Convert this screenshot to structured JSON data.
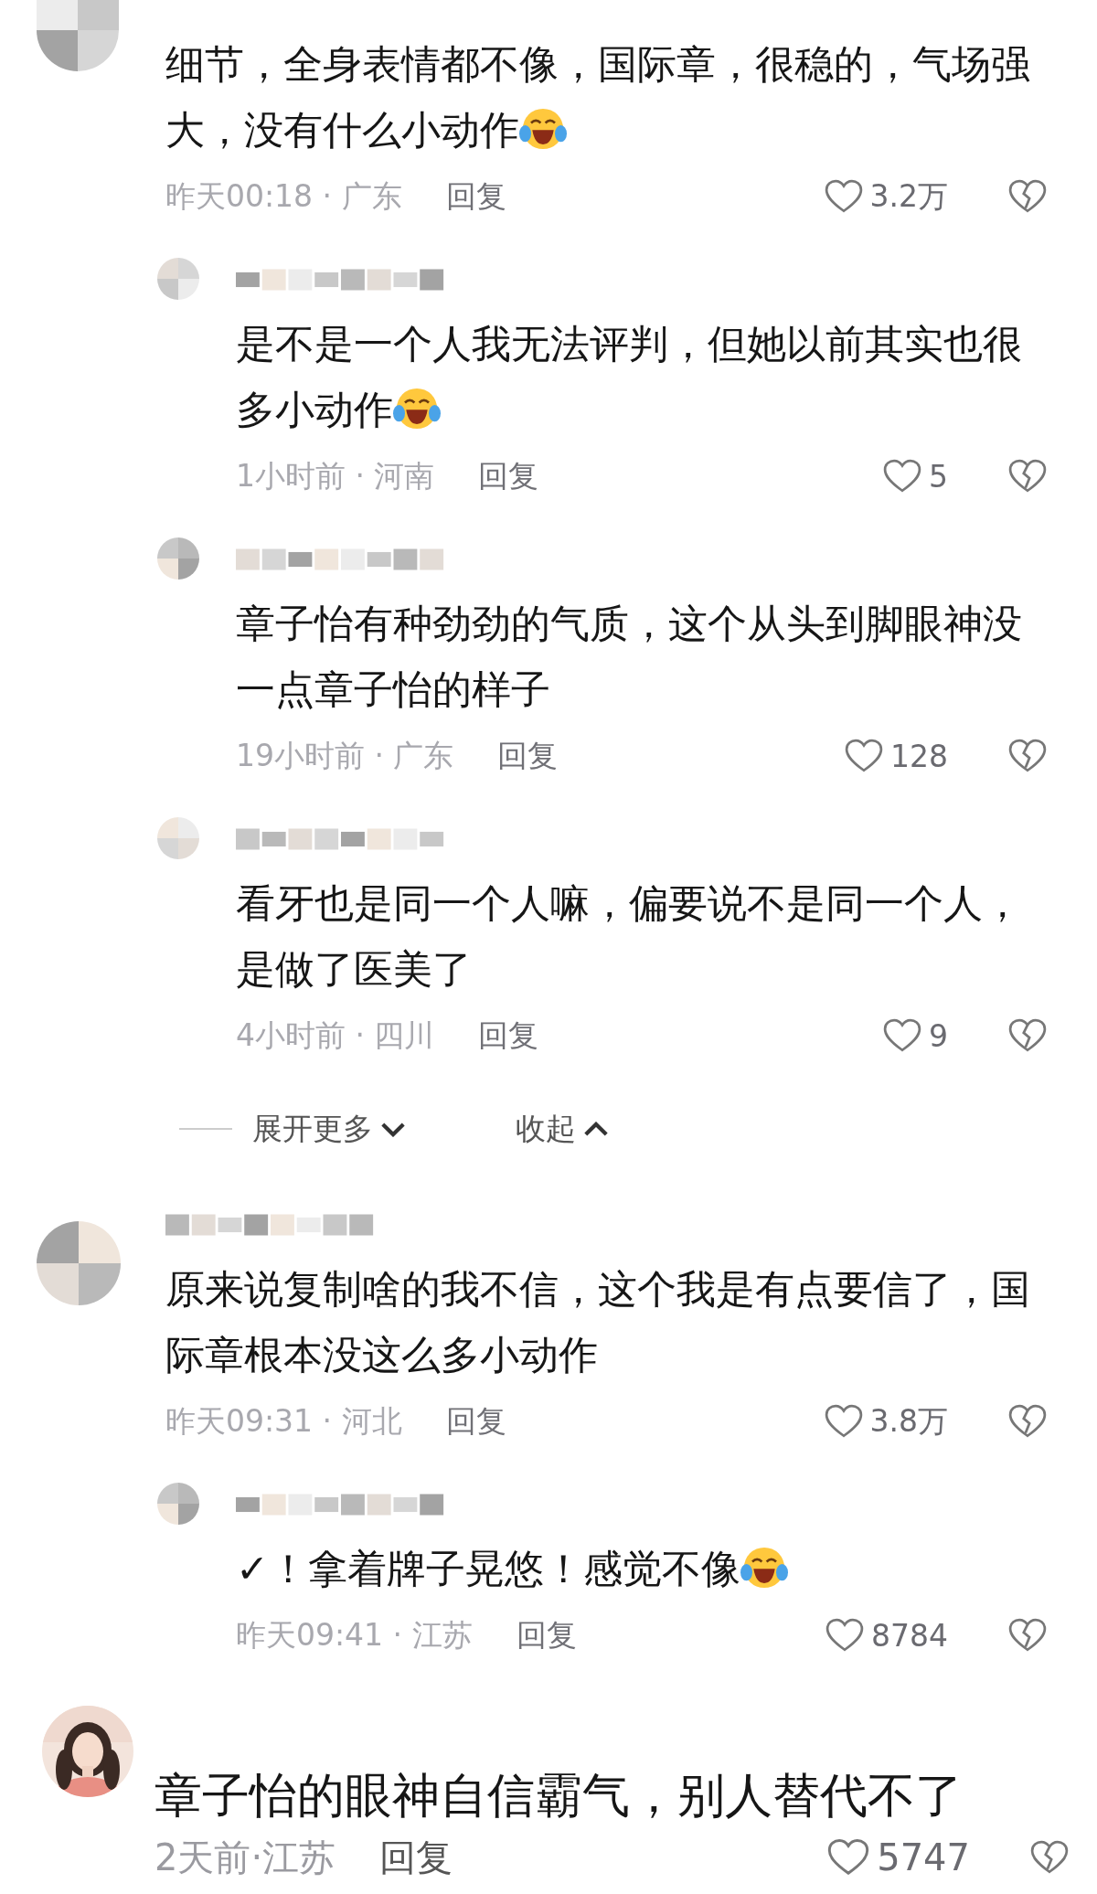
{
  "comments": [
    {
      "kind": "normal",
      "avatar": {
        "kind": "blurred"
      },
      "text": "细节，全身表情都不像，国际章，很稳的，气场强大，没有什么小动作",
      "trailing_emoji": true,
      "time_location": "昨天00:18 · 广东",
      "reply_label": "回复",
      "likes": "3.2万",
      "replies": [
        {
          "avatar": {
            "kind": "blurred"
          },
          "name_blurred": true,
          "text": "是不是一个人我无法评判，但她以前其实也很多小动作",
          "trailing_emoji": true,
          "time_location": "1小时前 · 河南",
          "reply_label": "回复",
          "likes": "5"
        },
        {
          "avatar": {
            "kind": "blurred"
          },
          "name_blurred": true,
          "text": "章子怡有种劲劲的气质，这个从头到脚眼神没一点章子怡的样子",
          "trailing_emoji": false,
          "time_location": "19小时前 · 广东",
          "reply_label": "回复",
          "likes": "128"
        },
        {
          "avatar": {
            "kind": "blurred"
          },
          "name_blurred": true,
          "text": "看牙也是同一个人嘛，偏要说不是同一个人，是做了医美了",
          "trailing_emoji": false,
          "time_location": "4小时前 · 四川",
          "reply_label": "回复",
          "likes": "9"
        }
      ],
      "thread_controls": {
        "expand": "展开更多",
        "collapse": "收起"
      }
    },
    {
      "kind": "normal",
      "avatar": {
        "kind": "blurred"
      },
      "name_blurred": true,
      "text": "原来说复制啥的我不信，这个我是有点要信了，国际章根本没这么多小动作",
      "trailing_emoji": false,
      "time_location": "昨天09:31 · 河北",
      "reply_label": "回复",
      "likes": "3.8万",
      "replies": [
        {
          "avatar": {
            "kind": "blurred"
          },
          "name_blurred": true,
          "text": "✓！拿着牌子晃悠！感觉不像",
          "trailing_emoji": true,
          "time_location": "昨天09:41 · 江苏",
          "reply_label": "回复",
          "likes": "8784"
        }
      ]
    },
    {
      "kind": "large",
      "text": "章子怡的眼神自信霸气，别人替代不了",
      "trailing_emoji": false,
      "time_location": "2天前·江苏",
      "reply_label": "回复",
      "likes": "5747"
    }
  ]
}
